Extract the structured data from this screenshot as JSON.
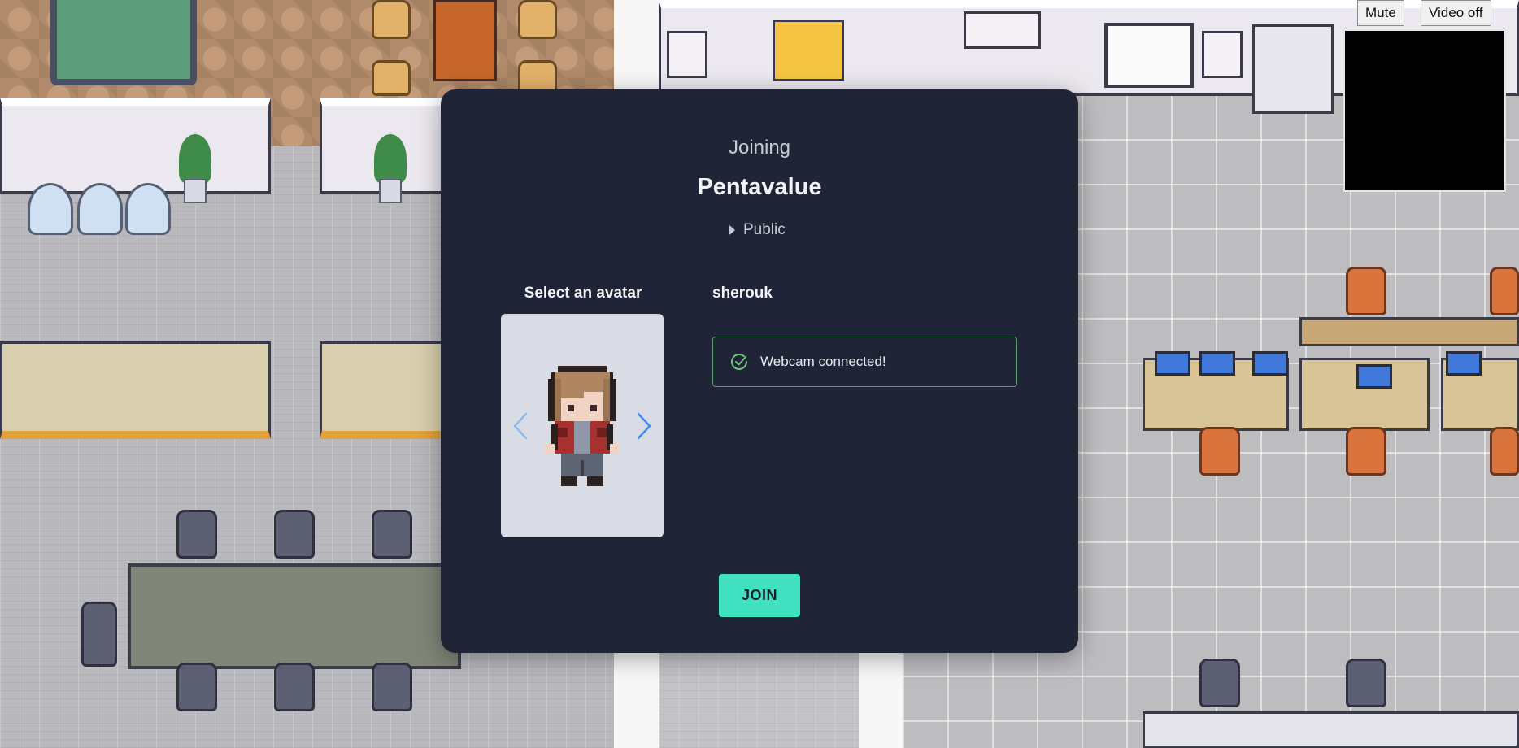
{
  "modal": {
    "joining_label": "Joining",
    "space_name": "Pentavalue",
    "visibility": "Public",
    "avatar_section_label": "Select an avatar",
    "username": "sherouk",
    "webcam_status": "Webcam connected!",
    "join_label": "JOIN"
  },
  "controls": {
    "mute_label": "Mute",
    "video_label": "Video off"
  },
  "colors": {
    "modal_bg": "#1f2436",
    "join_button": "#3fe1c0",
    "success_border": "#5c9c6a",
    "arrow_blue": "#3d8ef0"
  },
  "icons": {
    "prev_avatar": "chevron-left-icon",
    "next_avatar": "chevron-right-icon",
    "webcam_status": "check-circle-icon",
    "visibility_toggle": "caret-right-icon"
  }
}
